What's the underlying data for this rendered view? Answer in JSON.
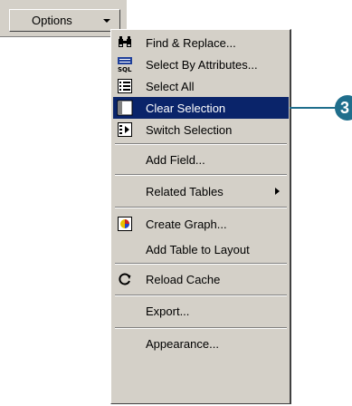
{
  "toolbar": {
    "options_label": "Options"
  },
  "menu": {
    "items": [
      {
        "label": "Find & Replace...",
        "icon": "binoculars-icon"
      },
      {
        "label": "Select By Attributes...",
        "icon": "sql-icon"
      },
      {
        "label": "Select All",
        "icon": "select-all-icon"
      },
      {
        "label": "Clear Selection",
        "icon": "clear-selection-icon",
        "selected": true
      },
      {
        "label": "Switch Selection",
        "icon": "switch-selection-icon"
      },
      {
        "label": "Add Field..."
      },
      {
        "label": "Related Tables",
        "has_submenu": true
      },
      {
        "label": "Create Graph...",
        "icon": "graph-icon"
      },
      {
        "label": "Add Table to Layout"
      },
      {
        "label": "Reload Cache",
        "icon": "reload-icon"
      },
      {
        "label": "Export..."
      },
      {
        "label": "Appearance..."
      }
    ]
  },
  "callout": {
    "number": "3",
    "color": "#1f6e8c"
  },
  "colors": {
    "menu_bg": "#d4d0c8",
    "highlight": "#0a246a"
  }
}
